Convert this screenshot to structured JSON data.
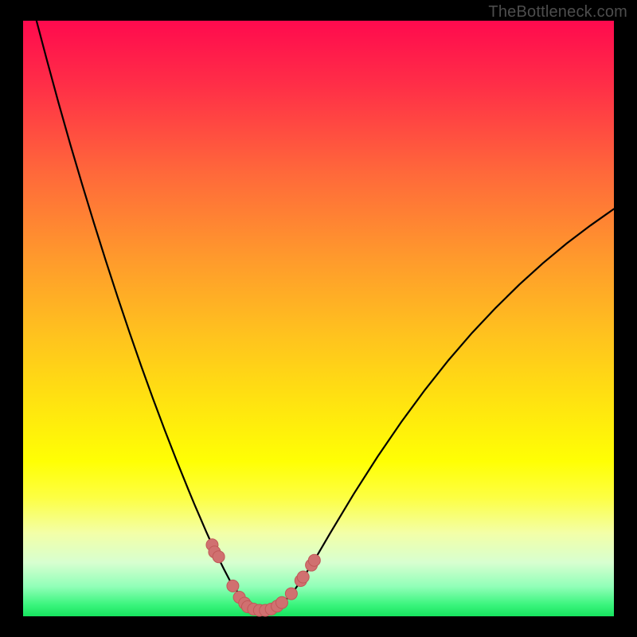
{
  "watermark": {
    "text": "TheBottleneck.com"
  },
  "colors": {
    "page_bg": "#000000",
    "curve_stroke": "#000000",
    "marker_fill": "#d07070",
    "marker_stroke": "#c05858"
  },
  "chart_data": {
    "type": "line",
    "title": "",
    "xlabel": "",
    "ylabel": "",
    "xlim": [
      0,
      100
    ],
    "ylim": [
      0,
      100
    ],
    "grid": false,
    "x": [
      0,
      2,
      4,
      6,
      8,
      10,
      12,
      14,
      16,
      18,
      20,
      22,
      24,
      26,
      28,
      29,
      30,
      31,
      32,
      33,
      34,
      35,
      36,
      37,
      38,
      39,
      40,
      42,
      44,
      46,
      48,
      50,
      52,
      56,
      60,
      64,
      68,
      72,
      76,
      80,
      84,
      88,
      92,
      96,
      100
    ],
    "values": [
      109,
      101,
      93.5,
      86.2,
      79.2,
      72.5,
      66,
      59.7,
      53.6,
      47.7,
      42,
      36.5,
      31.2,
      26.1,
      21.2,
      18.8,
      16.5,
      14.2,
      12,
      9.9,
      7.9,
      6,
      4.5,
      3.2,
      2.2,
      1.4,
      1,
      1.1,
      2.2,
      4.5,
      7.4,
      10.6,
      14.0,
      20.6,
      26.8,
      32.6,
      38.0,
      43.0,
      47.6,
      51.8,
      55.7,
      59.3,
      62.6,
      65.6,
      68.4
    ],
    "markers": [
      {
        "x": 32.0,
        "y": 12.0
      },
      {
        "x": 32.4,
        "y": 10.8
      },
      {
        "x": 33.1,
        "y": 10.0
      },
      {
        "x": 35.5,
        "y": 5.1
      },
      {
        "x": 36.6,
        "y": 3.2
      },
      {
        "x": 37.5,
        "y": 2.2
      },
      {
        "x": 38.0,
        "y": 1.6
      },
      {
        "x": 39.0,
        "y": 1.2
      },
      {
        "x": 40.0,
        "y": 1.0
      },
      {
        "x": 41.0,
        "y": 1.0
      },
      {
        "x": 42.0,
        "y": 1.2
      },
      {
        "x": 43.0,
        "y": 1.7
      },
      {
        "x": 43.8,
        "y": 2.3
      },
      {
        "x": 45.4,
        "y": 3.8
      },
      {
        "x": 47.0,
        "y": 6.0
      },
      {
        "x": 47.4,
        "y": 6.6
      },
      {
        "x": 48.8,
        "y": 8.6
      },
      {
        "x": 49.3,
        "y": 9.4
      }
    ]
  }
}
